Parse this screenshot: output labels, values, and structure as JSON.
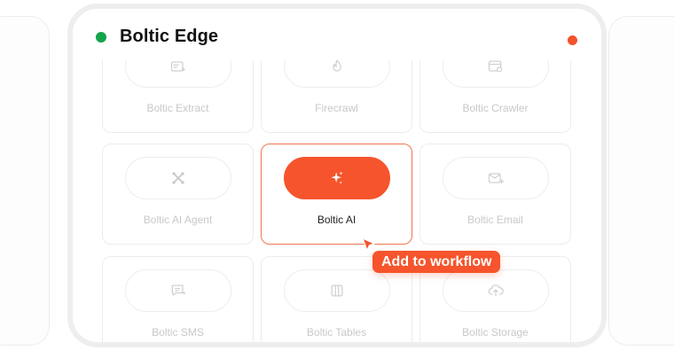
{
  "app": {
    "title": "Boltic Edge",
    "status_color": "#13a44b",
    "record_color": "#f2532c",
    "accent": "#f6542c"
  },
  "cards": [
    {
      "label": "Boltic Extract",
      "icon": "extract-icon"
    },
    {
      "label": "Firecrawl",
      "icon": "fire-icon"
    },
    {
      "label": "Boltic Crawler",
      "icon": "crawler-icon"
    },
    {
      "label": "Boltic AI Agent",
      "icon": "agent-icon"
    },
    {
      "label": "Boltic AI",
      "icon": "sparkle-icon",
      "selected": true
    },
    {
      "label": "Boltic Email",
      "icon": "email-icon"
    },
    {
      "label": "Boltic SMS",
      "icon": "sms-icon"
    },
    {
      "label": "Boltic Tables",
      "icon": "table-icon"
    },
    {
      "label": "Boltic Storage",
      "icon": "storage-icon"
    }
  ],
  "tooltip": {
    "label": "Add to workflow"
  }
}
